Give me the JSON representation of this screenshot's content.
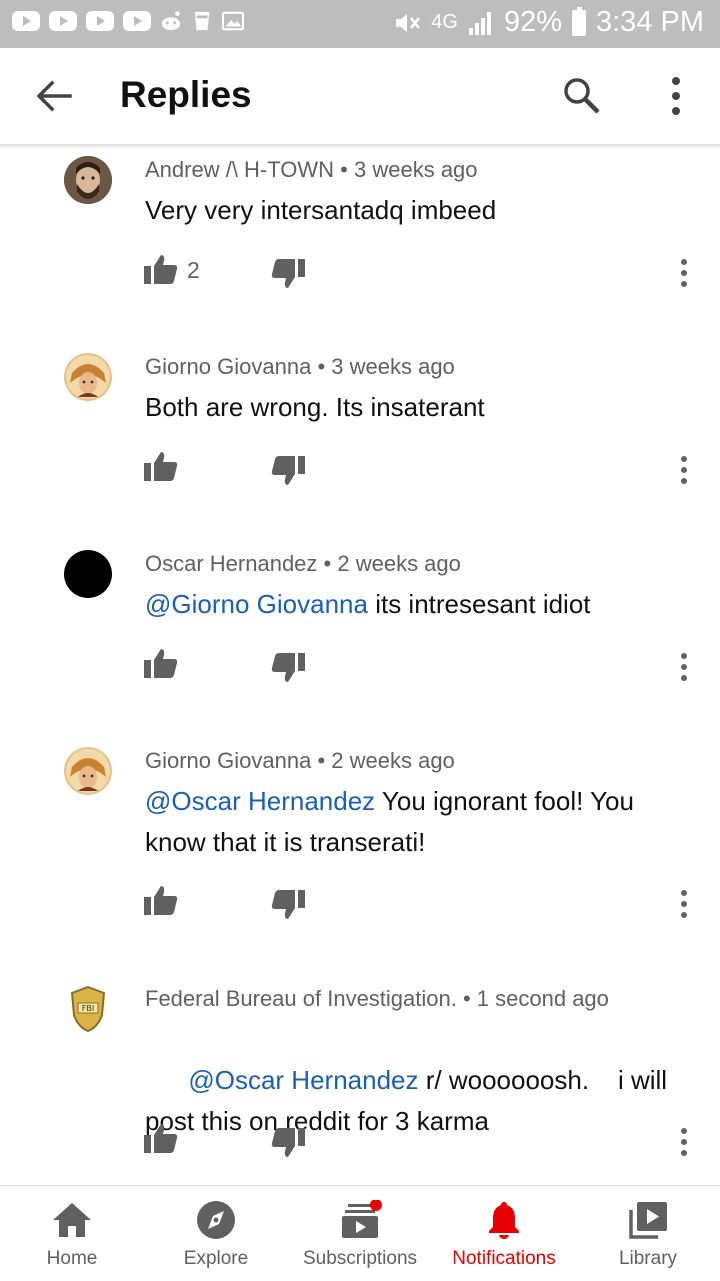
{
  "status_bar": {
    "network": "4G",
    "battery": "92%",
    "time": "3:34 PM"
  },
  "header": {
    "title": "Replies",
    "back_icon": "arrow-back-icon",
    "search_icon": "search-icon",
    "more_icon": "more-vert-icon"
  },
  "comments": [
    {
      "author": "Andrew /\\ H-TOWN",
      "time": "3 weeks ago",
      "mention": "",
      "text": "Very very intersantadq imbeed",
      "likes": "2"
    },
    {
      "author": "Giorno Giovanna",
      "time": "3 weeks ago",
      "mention": "",
      "text": "Both are wrong. Its insaterant",
      "likes": ""
    },
    {
      "author": "Oscar Hernandez",
      "time": "2 weeks ago",
      "mention": "@Giorno Giovanna",
      "text": " its intresesant idiot",
      "likes": ""
    },
    {
      "author": "Giorno Giovanna",
      "time": "2 weeks ago",
      "mention": "@Oscar Hernandez",
      "text": " You ignorant fool! You know that it is transerati!",
      "likes": ""
    },
    {
      "author": "Federal Bureau of Investigation.",
      "time": "1 second ago",
      "mention": "@Oscar Hernandez",
      "text": " r/ woooooosh.    i will post this on reddit for 3 karma",
      "likes": ""
    }
  ],
  "separator": " • ",
  "bottom_nav": {
    "items": [
      {
        "label": "Home",
        "icon": "home-icon"
      },
      {
        "label": "Explore",
        "icon": "compass-icon"
      },
      {
        "label": "Subscriptions",
        "icon": "subscriptions-icon"
      },
      {
        "label": "Notifications",
        "icon": "bell-icon"
      },
      {
        "label": "Library",
        "icon": "library-icon"
      }
    ],
    "active_color": "#e60000",
    "inactive_color": "#606060"
  },
  "colors": {
    "status_bar": "#bdbdbd",
    "mention": "#1a5fb4",
    "notification_dot": "#e60000"
  }
}
